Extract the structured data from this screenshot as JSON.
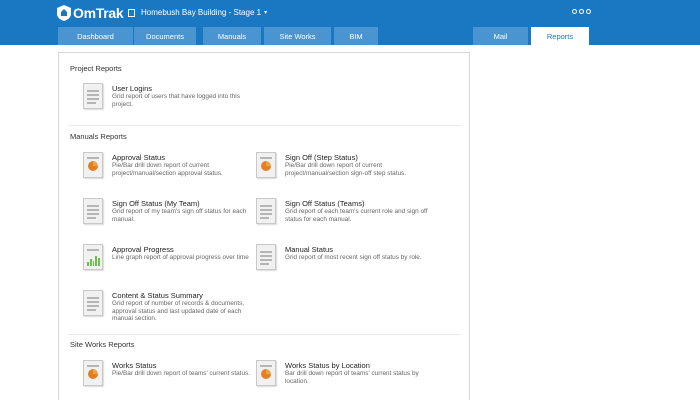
{
  "header": {
    "brand": "OmTrak",
    "project": "Homebush Bay Building - Stage 1",
    "project_caret": "▾"
  },
  "nav": {
    "tabs": [
      {
        "label": "Dashboard"
      },
      {
        "label": "Documents"
      },
      {
        "label": "Manuals"
      },
      {
        "label": "Site Works"
      },
      {
        "label": "BIM"
      }
    ],
    "right_tabs": [
      {
        "label": "Mail"
      },
      {
        "label": "Reports",
        "active": true
      }
    ]
  },
  "sections": [
    {
      "title": "Project Reports",
      "reports": [
        {
          "title": "User Logins",
          "description": "Grid report of users that have logged into this project.",
          "icon": "grid-report-icon"
        }
      ]
    },
    {
      "title": "Manuals Reports",
      "reports": [
        {
          "title": "Approval Status",
          "description": "Pie/Bar drill down report of current project/manual/section approval status.",
          "icon": "pie-chart-report-icon"
        },
        {
          "title": "Sign Off (Step Status)",
          "description": "Pie/Bar drill down report of current project/manual/section sign-off step status.",
          "icon": "pie-chart-report-icon"
        },
        {
          "title": "Sign Off Status (My Team)",
          "description": "Grid report of my team's sign off status for each manual.",
          "icon": "grid-report-icon"
        },
        {
          "title": "Sign Off Status (Teams)",
          "description": "Grid report of each team's current role and sign off status for each manual.",
          "icon": "grid-report-icon"
        },
        {
          "title": "Approval Progress",
          "description": "Line graph report of approval progress over time",
          "icon": "line-graph-report-icon"
        },
        {
          "title": "Manual Status",
          "description": "Grid report of most recent sign off status by role.",
          "icon": "grid-report-icon"
        },
        {
          "title": "Content & Status Summary",
          "description": "Grid report of number of records & documents, approval status and last updated date of each manual section.",
          "icon": "grid-report-icon"
        }
      ]
    },
    {
      "title": "Site Works Reports",
      "reports": [
        {
          "title": "Works Status",
          "description": "Pie/Bar drill down report of teams' current status.",
          "icon": "pie-chart-report-icon"
        },
        {
          "title": "Works Status by Location",
          "description": "Bar drill down report of teams' current status by location.",
          "icon": "pie-chart-report-icon"
        }
      ]
    }
  ],
  "colors": {
    "brand_blue": "#1a78c2",
    "tab_blue": "#4a95d1",
    "pie_orange": "#e67e22",
    "graph_green": "#6fbf4b"
  }
}
